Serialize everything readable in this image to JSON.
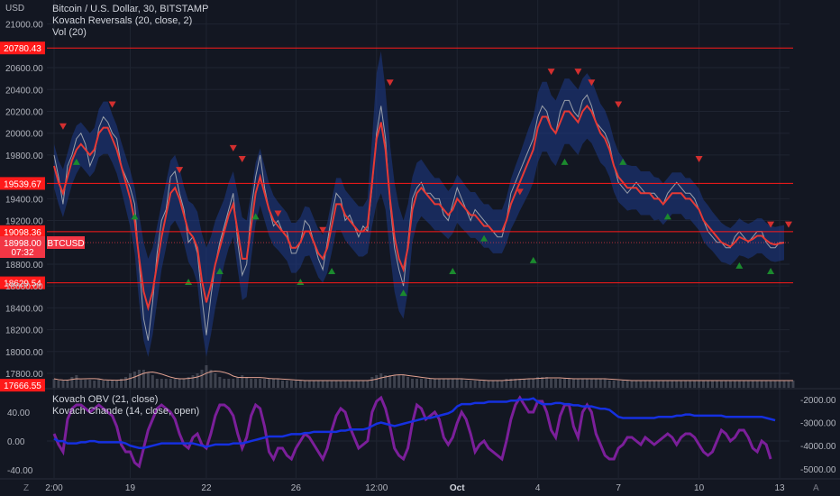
{
  "price_axis": {
    "currency": "USD",
    "ticks": [
      "21000.00",
      "20600.00",
      "20400.00",
      "20200.00",
      "20000.00",
      "19800.00",
      "19400.00",
      "19200.00",
      "18800.00",
      "18600.00",
      "18400.00",
      "18200.00",
      "18000.00",
      "17800.00"
    ],
    "tick_values": [
      21000,
      20600,
      20400,
      20200,
      20000,
      19800,
      19400,
      19200,
      18800,
      18600,
      18400,
      18200,
      18000,
      17800
    ]
  },
  "time_axis": {
    "ticks": [
      "2:00",
      "19",
      "22",
      "26",
      "12:00",
      "Oct",
      "4",
      "7",
      "10",
      "13"
    ],
    "tick_index": [
      0,
      17,
      34,
      54,
      72,
      90,
      108,
      126,
      144,
      162
    ]
  },
  "indicator_axis_left": {
    "ticks": [
      "40.00",
      "0.00",
      "-40.00"
    ],
    "values": [
      40,
      0,
      -40
    ]
  },
  "indicator_axis_right": {
    "ticks": [
      "-2000.00",
      "-3000.00",
      "-4000.00",
      "-5000.00"
    ],
    "values": [
      -2000,
      -3000,
      -4000,
      -5000
    ]
  },
  "legend": {
    "symbol": "Bitcoin / U.S. Dollar, 30, BITSTAMP",
    "study1": "Kovach Reversals (20, close, 2)",
    "study2": "Vol (20)",
    "study3": "Kovach OBV (21, close)",
    "study4": "Kovach Chande (14, close, open)"
  },
  "levels": [
    {
      "label": "20780.43",
      "value": 20780.43
    },
    {
      "label": "19539.67",
      "value": 19539.67
    },
    {
      "label": "19098.36",
      "value": 19098.36
    },
    {
      "label": "18629.54",
      "value": 18629.54
    }
  ],
  "price_tag": {
    "value_label": "18998.00",
    "value": 18998,
    "symbol": "BTCUSD",
    "countdown": "07:32"
  },
  "low_tag": {
    "label": "17666.55",
    "value": 17666.55
  },
  "corner_left": "Z",
  "corner_right": "A",
  "colors": {
    "background": "#131722",
    "grid": "#1f2431",
    "level": "#ff1a1a",
    "band": "#1e3a8a",
    "kovach_line": "#e53935",
    "price": "#9aa0aa",
    "up_marker": "#1b8a2e",
    "down_marker": "#d32f2f",
    "obv": "#1530e0",
    "chande": "#7b1f9a",
    "volume": "#4a4e5a",
    "vol_ma": "#e0a090"
  },
  "chart_data": {
    "type": "line",
    "x_labels": [
      "2:00",
      "19",
      "22",
      "26",
      "12:00",
      "Oct",
      "4",
      "7",
      "10",
      "13"
    ],
    "x_label_index": [
      0,
      17,
      34,
      54,
      72,
      90,
      108,
      126,
      144,
      162
    ],
    "ylim": [
      17666.55,
      21200
    ],
    "price_close": [
      19800,
      19600,
      19350,
      19700,
      19800,
      19950,
      20000,
      19900,
      19700,
      19800,
      20050,
      20150,
      20100,
      20000,
      19950,
      19700,
      19600,
      19500,
      19350,
      18800,
      18300,
      18100,
      18450,
      18900,
      19200,
      19300,
      19600,
      19650,
      19450,
      19300,
      19000,
      19050,
      18900,
      18500,
      18150,
      18500,
      18800,
      19000,
      19150,
      19300,
      19450,
      19000,
      18700,
      18800,
      19300,
      19600,
      19800,
      19500,
      19300,
      19150,
      19200,
      19100,
      19100,
      18900,
      18900,
      19000,
      19200,
      19150,
      19000,
      18850,
      18750,
      19000,
      19250,
      19450,
      19400,
      19200,
      19250,
      19150,
      19050,
      19150,
      19100,
      19500,
      20000,
      20250,
      19950,
      19350,
      18950,
      18750,
      18600,
      19000,
      19400,
      19500,
      19550,
      19450,
      19450,
      19400,
      19400,
      19250,
      19200,
      19350,
      19500,
      19400,
      19300,
      19200,
      19300,
      19250,
      19200,
      19150,
      19100,
      19050,
      19050,
      19200,
      19450,
      19550,
      19650,
      19750,
      19850,
      19950,
      20150,
      20250,
      20200,
      20050,
      20000,
      20200,
      20300,
      20300,
      20200,
      20150,
      20300,
      20350,
      20250,
      20100,
      20050,
      20000,
      19900,
      19700,
      19550,
      19500,
      19450,
      19500,
      19550,
      19500,
      19450,
      19450,
      19450,
      19400,
      19350,
      19450,
      19500,
      19550,
      19500,
      19450,
      19450,
      19400,
      19300,
      19200,
      19100,
      19050,
      19000,
      19000,
      18950,
      18950,
      19050,
      19100,
      19050,
      19000,
      19050,
      19100,
      19100,
      19000,
      18950,
      18950,
      19000,
      18998
    ],
    "kovach_reversals": [
      19700,
      19550,
      19450,
      19600,
      19750,
      19850,
      19900,
      19850,
      19800,
      19850,
      20000,
      20050,
      20050,
      19950,
      19850,
      19700,
      19550,
      19400,
      19200,
      18850,
      18550,
      18400,
      18550,
      18800,
      19050,
      19250,
      19450,
      19500,
      19400,
      19250,
      19100,
      19050,
      18950,
      18650,
      18450,
      18600,
      18800,
      18950,
      19100,
      19250,
      19350,
      19100,
      18850,
      18850,
      19150,
      19450,
      19600,
      19450,
      19300,
      19200,
      19150,
      19100,
      19050,
      18950,
      18950,
      19000,
      19100,
      19100,
      19000,
      18900,
      18850,
      18950,
      19150,
      19350,
      19350,
      19250,
      19200,
      19150,
      19100,
      19100,
      19150,
      19550,
      19950,
      20100,
      19850,
      19400,
      19050,
      18850,
      18750,
      18950,
      19300,
      19450,
      19500,
      19450,
      19400,
      19350,
      19350,
      19300,
      19250,
      19300,
      19400,
      19350,
      19300,
      19250,
      19250,
      19200,
      19150,
      19150,
      19100,
      19100,
      19100,
      19200,
      19350,
      19450,
      19550,
      19650,
      19750,
      19850,
      20050,
      20150,
      20150,
      20050,
      20000,
      20100,
      20200,
      20200,
      20150,
      20100,
      20200,
      20250,
      20200,
      20100,
      20000,
      19950,
      19850,
      19700,
      19600,
      19550,
      19500,
      19500,
      19500,
      19450,
      19450,
      19450,
      19400,
      19400,
      19350,
      19400,
      19450,
      19450,
      19450,
      19400,
      19400,
      19350,
      19300,
      19200,
      19150,
      19100,
      19050,
      19000,
      18980,
      18960,
      19000,
      19050,
      19030,
      19010,
      19030,
      19060,
      19060,
      19020,
      18990,
      18980,
      18990,
      18998
    ],
    "band_width": [
      200,
      200,
      220,
      220,
      220,
      220,
      200,
      200,
      200,
      200,
      220,
      240,
      240,
      220,
      220,
      220,
      240,
      260,
      300,
      400,
      450,
      450,
      400,
      350,
      300,
      300,
      300,
      300,
      280,
      260,
      280,
      300,
      330,
      430,
      500,
      450,
      400,
      350,
      300,
      300,
      300,
      350,
      380,
      350,
      300,
      280,
      260,
      250,
      240,
      230,
      220,
      220,
      220,
      230,
      230,
      230,
      230,
      220,
      220,
      220,
      220,
      230,
      240,
      240,
      240,
      230,
      230,
      230,
      230,
      230,
      250,
      400,
      600,
      650,
      550,
      500,
      500,
      480,
      450,
      400,
      300,
      280,
      260,
      250,
      240,
      240,
      240,
      230,
      220,
      220,
      220,
      220,
      210,
      210,
      210,
      200,
      200,
      200,
      200,
      200,
      200,
      210,
      230,
      250,
      260,
      280,
      300,
      300,
      320,
      320,
      320,
      300,
      300,
      300,
      300,
      300,
      300,
      300,
      300,
      300,
      290,
      280,
      270,
      260,
      250,
      240,
      230,
      220,
      210,
      200,
      200,
      200,
      200,
      200,
      200,
      190,
      190,
      190,
      190,
      190,
      190,
      190,
      190,
      190,
      190,
      190,
      190,
      180,
      180,
      180,
      170,
      170,
      170,
      170,
      160,
      160,
      160,
      160,
      160,
      160,
      160,
      160,
      160,
      160
    ],
    "down_markers": [
      [
        2,
        20000
      ],
      [
        13,
        20200
      ],
      [
        28,
        19600
      ],
      [
        40,
        19800
      ],
      [
        42,
        19700
      ],
      [
        50,
        19200
      ],
      [
        60,
        19050
      ],
      [
        75,
        20400
      ],
      [
        104,
        19400
      ],
      [
        111,
        20500
      ],
      [
        117,
        20500
      ],
      [
        120,
        20400
      ],
      [
        126,
        20200
      ],
      [
        144,
        19700
      ],
      [
        160,
        19100
      ],
      [
        164,
        19100
      ]
    ],
    "up_markers": [
      [
        5,
        19800
      ],
      [
        18,
        19300
      ],
      [
        30,
        18700
      ],
      [
        37,
        18800
      ],
      [
        45,
        19300
      ],
      [
        55,
        18700
      ],
      [
        62,
        18800
      ],
      [
        78,
        18600
      ],
      [
        89,
        18800
      ],
      [
        96,
        19100
      ],
      [
        107,
        18900
      ],
      [
        114,
        19800
      ],
      [
        127,
        19800
      ],
      [
        137,
        19300
      ],
      [
        153,
        18850
      ],
      [
        160,
        18800
      ]
    ],
    "obv": [
      -3700,
      -3800,
      -3800,
      -3900,
      -3900,
      -3900,
      -3850,
      -3850,
      -3800,
      -3800,
      -3850,
      -3850,
      -3850,
      -3850,
      -3850,
      -3850,
      -3900,
      -4000,
      -4050,
      -4100,
      -4100,
      -4050,
      -4000,
      -3950,
      -3900,
      -3900,
      -3900,
      -3900,
      -3900,
      -3900,
      -3900,
      -3900,
      -3950,
      -4000,
      -4050,
      -4000,
      -3950,
      -3950,
      -3950,
      -3950,
      -3900,
      -3900,
      -3900,
      -3850,
      -3800,
      -3750,
      -3700,
      -3650,
      -3600,
      -3600,
      -3600,
      -3600,
      -3550,
      -3500,
      -3500,
      -3500,
      -3450,
      -3450,
      -3400,
      -3400,
      -3400,
      -3400,
      -3400,
      -3400,
      -3350,
      -3350,
      -3300,
      -3300,
      -3300,
      -3300,
      -3250,
      -3150,
      -3050,
      -3000,
      -3050,
      -3100,
      -3150,
      -3100,
      -3050,
      -3000,
      -2950,
      -2900,
      -2850,
      -2800,
      -2800,
      -2750,
      -2700,
      -2650,
      -2600,
      -2500,
      -2300,
      -2200,
      -2200,
      -2200,
      -2150,
      -2150,
      -2150,
      -2100,
      -2100,
      -2100,
      -2100,
      -2100,
      -2050,
      -2050,
      -2000,
      -2000,
      -2000,
      -1950,
      -2100,
      -2200,
      -2200,
      -2200,
      -2150,
      -2150,
      -2200,
      -2200,
      -2250,
      -2250,
      -2300,
      -2300,
      -2300,
      -2350,
      -2400,
      -2400,
      -2450,
      -2600,
      -2750,
      -2800,
      -2800,
      -2800,
      -2800,
      -2800,
      -2800,
      -2800,
      -2800,
      -2750,
      -2750,
      -2750,
      -2750,
      -2700,
      -2700,
      -2650,
      -2650,
      -2700,
      -2700,
      -2700,
      -2700,
      -2700,
      -2700,
      -2700,
      -2750,
      -2750,
      -2750,
      -2750,
      -2750,
      -2750,
      -2750,
      -2750,
      -2750,
      -2800,
      -2850,
      -2900
    ],
    "chande": [
      10,
      -5,
      -15,
      30,
      45,
      50,
      50,
      45,
      40,
      45,
      50,
      45,
      40,
      35,
      20,
      -5,
      -15,
      -15,
      -30,
      -35,
      -10,
      15,
      30,
      45,
      50,
      45,
      40,
      30,
      10,
      -5,
      -10,
      5,
      10,
      -5,
      -10,
      10,
      35,
      50,
      50,
      45,
      35,
      10,
      -10,
      5,
      35,
      50,
      45,
      20,
      -15,
      -25,
      -10,
      -10,
      -20,
      -25,
      -10,
      0,
      10,
      5,
      -5,
      -15,
      -25,
      -10,
      15,
      35,
      45,
      40,
      20,
      5,
      -10,
      -5,
      0,
      40,
      55,
      60,
      45,
      20,
      -10,
      -20,
      -25,
      -10,
      25,
      50,
      45,
      30,
      35,
      40,
      30,
      5,
      -5,
      5,
      25,
      40,
      30,
      10,
      -15,
      -5,
      0,
      -10,
      -15,
      -20,
      -25,
      0,
      30,
      50,
      60,
      50,
      40,
      40,
      55,
      55,
      40,
      15,
      5,
      35,
      50,
      50,
      20,
      5,
      40,
      50,
      40,
      10,
      -5,
      -20,
      -25,
      -25,
      -10,
      -5,
      5,
      5,
      0,
      -5,
      5,
      0,
      -5,
      0,
      5,
      10,
      5,
      -5,
      5,
      10,
      10,
      5,
      -5,
      -15,
      -20,
      -15,
      0,
      15,
      10,
      0,
      5,
      15,
      15,
      5,
      -10,
      -15,
      0,
      -5,
      -25
    ],
    "volume": [
      10,
      8,
      8,
      8,
      12,
      14,
      9,
      9,
      9,
      8,
      10,
      8,
      8,
      8,
      8,
      10,
      12,
      16,
      18,
      20,
      20,
      17,
      14,
      10,
      10,
      10,
      10,
      10,
      10,
      10,
      12,
      14,
      16,
      20,
      25,
      20,
      16,
      12,
      10,
      10,
      10,
      12,
      14,
      12,
      10,
      10,
      10,
      10,
      10,
      10,
      10,
      8,
      8,
      8,
      8,
      8,
      8,
      8,
      8,
      8,
      8,
      8,
      8,
      8,
      8,
      8,
      8,
      8,
      8,
      8,
      8,
      12,
      14,
      16,
      14,
      14,
      14,
      14,
      14,
      12,
      10,
      10,
      10,
      10,
      10,
      10,
      10,
      10,
      10,
      10,
      10,
      10,
      8,
      8,
      8,
      8,
      8,
      8,
      8,
      8,
      8,
      10,
      10,
      10,
      10,
      10,
      10,
      10,
      12,
      12,
      12,
      10,
      10,
      10,
      10,
      10,
      10,
      10,
      10,
      10,
      10,
      10,
      10,
      10,
      8,
      8,
      8,
      8,
      8,
      8,
      8,
      8,
      8,
      8,
      8,
      8,
      8,
      8,
      8,
      8,
      8,
      8,
      8,
      8,
      8,
      8,
      8,
      8,
      8,
      8,
      8,
      8,
      8,
      8,
      8,
      8,
      8,
      8,
      8,
      8,
      8,
      8,
      8,
      8,
      8,
      8
    ]
  }
}
